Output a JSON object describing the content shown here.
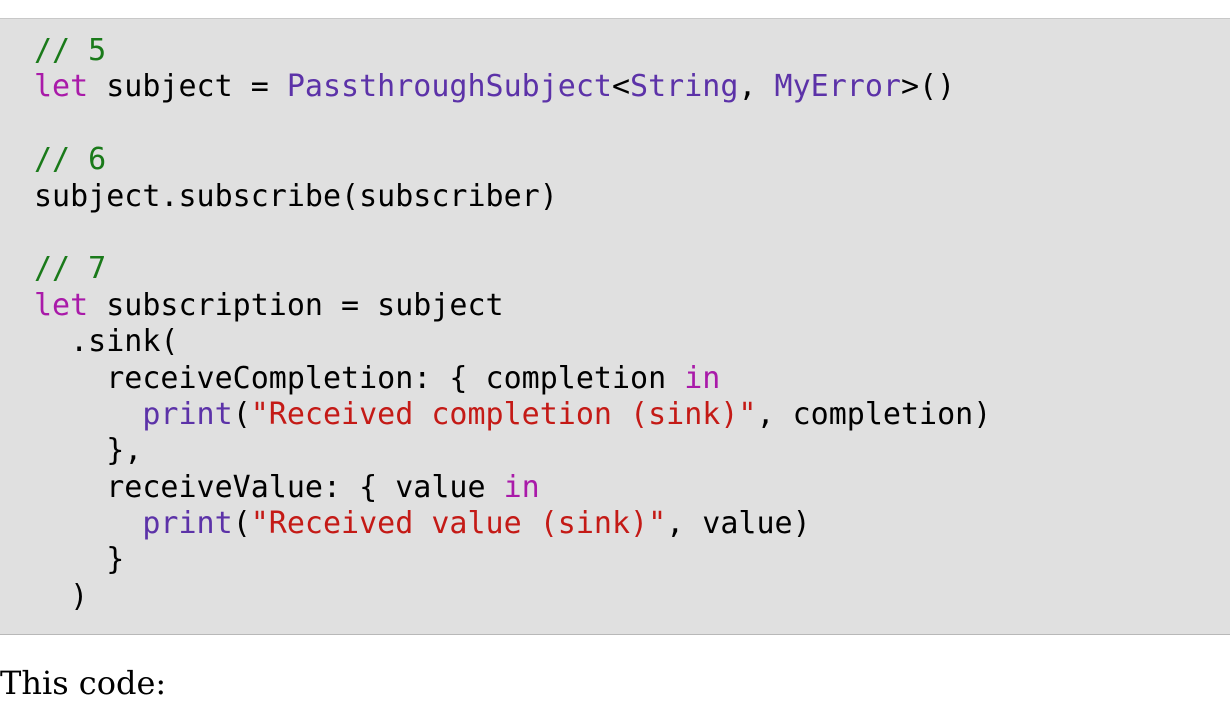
{
  "code": {
    "l1_comment": "// 5",
    "l2_kw": "let",
    "l2_text": " subject = ",
    "l2_type1": "PassthroughSubject",
    "l2_lt": "<",
    "l2_type2": "String",
    "l2_comma": ", ",
    "l2_type3": "MyError",
    "l2_end": ">()",
    "l4_comment": "// 6",
    "l5_text": "subject.subscribe(subscriber)",
    "l7_comment": "// 7",
    "l8_kw": "let",
    "l8_text": " subscription = subject",
    "l9_text": "  .sink(",
    "l10_text": "    receiveCompletion: { completion ",
    "l10_kw": "in",
    "l11_indent": "      ",
    "l11_func": "print",
    "l11_paren": "(",
    "l11_string": "\"Received completion (sink)\"",
    "l11_end": ", completion)",
    "l12_text": "    },",
    "l13_text": "    receiveValue: { value ",
    "l13_kw": "in",
    "l14_indent": "      ",
    "l14_func": "print",
    "l14_paren": "(",
    "l14_string": "\"Received value (sink)\"",
    "l14_end": ", value)",
    "l15_text": "    }",
    "l16_text": "  )"
  },
  "trailing": "This code:",
  "colors": {
    "background": "#e0e0e0",
    "comment": "#1a7a1a",
    "keyword": "#a91aa9",
    "type": "#5c32a8",
    "string": "#c41a16"
  }
}
